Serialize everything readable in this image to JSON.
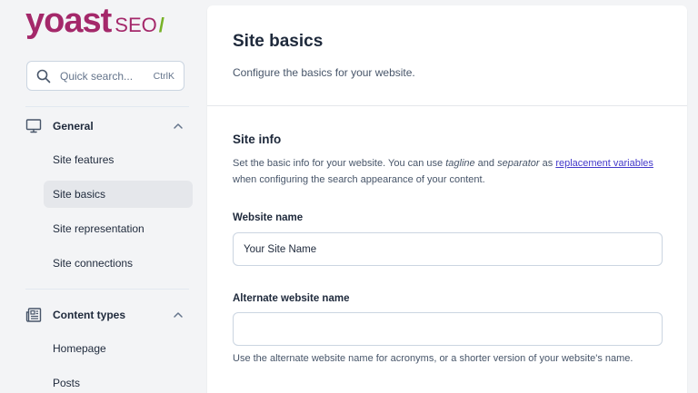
{
  "brand": {
    "name": "yoast",
    "product": "SEO",
    "slash": "/",
    "primary_color": "#a4286a",
    "accent_color": "#77b227"
  },
  "search": {
    "placeholder": "Quick search...",
    "shortcut": "CtrlK"
  },
  "sidebar": {
    "groups": [
      {
        "label": "General",
        "icon": "monitor-icon",
        "expanded": true,
        "items": [
          {
            "label": "Site features",
            "active": false
          },
          {
            "label": "Site basics",
            "active": true
          },
          {
            "label": "Site representation",
            "active": false
          },
          {
            "label": "Site connections",
            "active": false
          }
        ]
      },
      {
        "label": "Content types",
        "icon": "newspaper-icon",
        "expanded": true,
        "items": [
          {
            "label": "Homepage",
            "active": false
          },
          {
            "label": "Posts",
            "active": false
          }
        ]
      }
    ]
  },
  "main": {
    "title": "Site basics",
    "subtitle": "Configure the basics for your website.",
    "section": {
      "title": "Site info",
      "desc_part1": "Set the basic info for your website. You can use ",
      "desc_em1": "tagline",
      "desc_part2": " and ",
      "desc_em2": "separator",
      "desc_part3": " as ",
      "desc_link": "replacement variables",
      "desc_part4": " when configuring the search appearance of your content."
    },
    "fields": {
      "website_name": {
        "label": "Website name",
        "value": "Your Site Name"
      },
      "alternate_name": {
        "label": "Alternate website name",
        "value": "",
        "help": "Use the alternate website name for acronyms, or a shorter version of your website's name."
      }
    }
  }
}
